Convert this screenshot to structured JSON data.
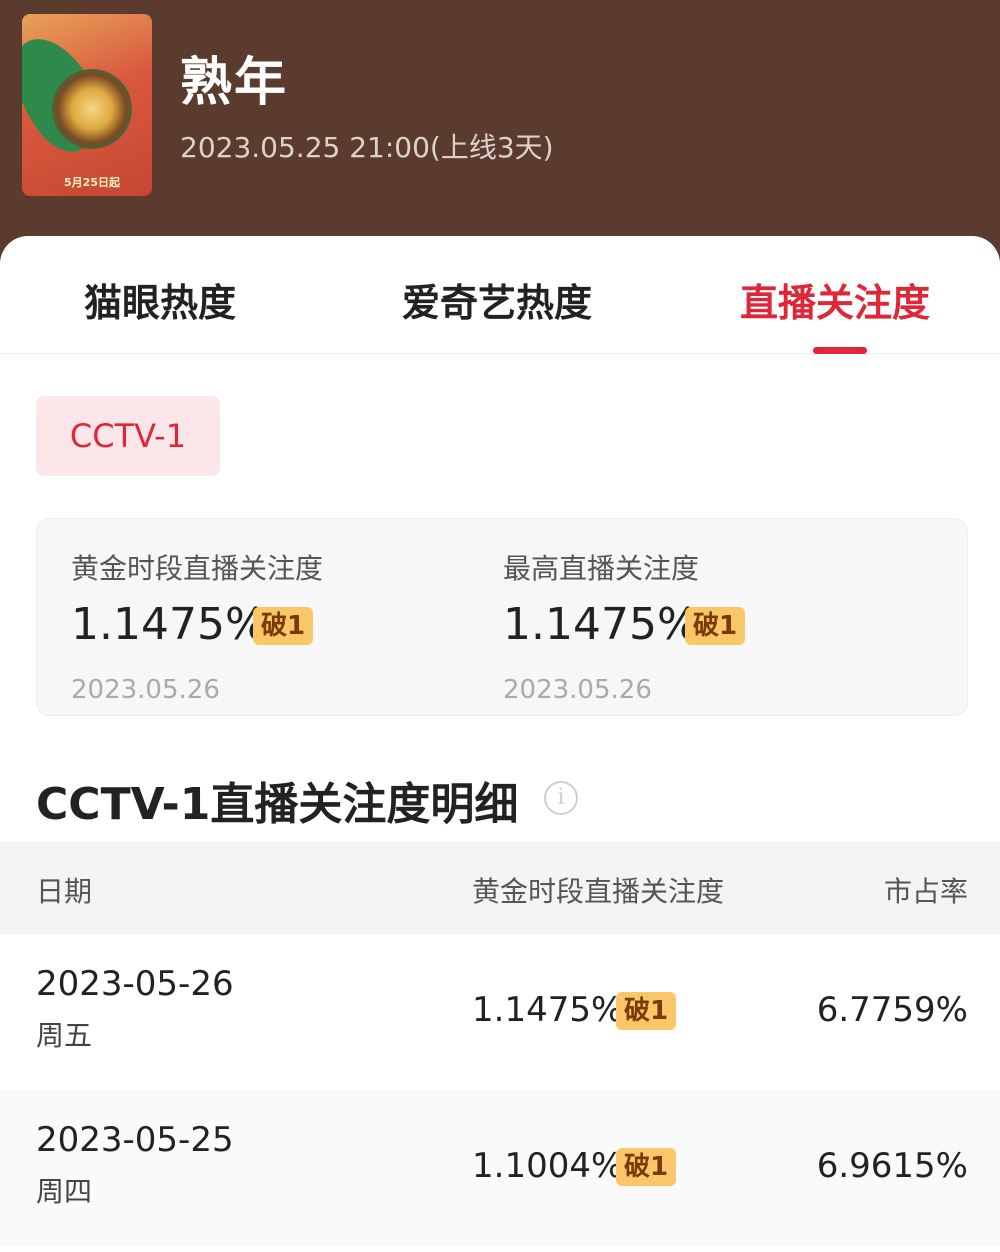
{
  "header": {
    "title": "熟年",
    "subtitle": "2023.05.25 21:00(上线3天)",
    "poster_caption": "5月25日起"
  },
  "tabs": [
    {
      "label": "猫眼热度"
    },
    {
      "label": "爱奇艺热度"
    },
    {
      "label": "直播关注度",
      "active": true
    }
  ],
  "channel_chip": "CCTV-1",
  "stats": [
    {
      "label": "黄金时段直播关注度",
      "value": "1.1475%",
      "badge": "破1",
      "date": "2023.05.26"
    },
    {
      "label": "最高直播关注度",
      "value": "1.1475%",
      "badge": "破1",
      "date": "2023.05.26"
    }
  ],
  "section": {
    "title": "CCTV-1直播关注度明细",
    "info_icon": "i"
  },
  "table": {
    "headers": [
      "日期",
      "黄金时段直播关注度",
      "市占率"
    ],
    "rows": [
      {
        "date": "2023-05-26",
        "weekday": "周五",
        "value": "1.1475%",
        "badge": "破1",
        "share": "6.7759%"
      },
      {
        "date": "2023-05-25",
        "weekday": "周四",
        "value": "1.1004%",
        "badge": "破1",
        "share": "6.9615%"
      }
    ]
  },
  "colors": {
    "header_bg": "#5b3b2e",
    "accent": "#e02739",
    "badge_bg": "#f9c767"
  }
}
